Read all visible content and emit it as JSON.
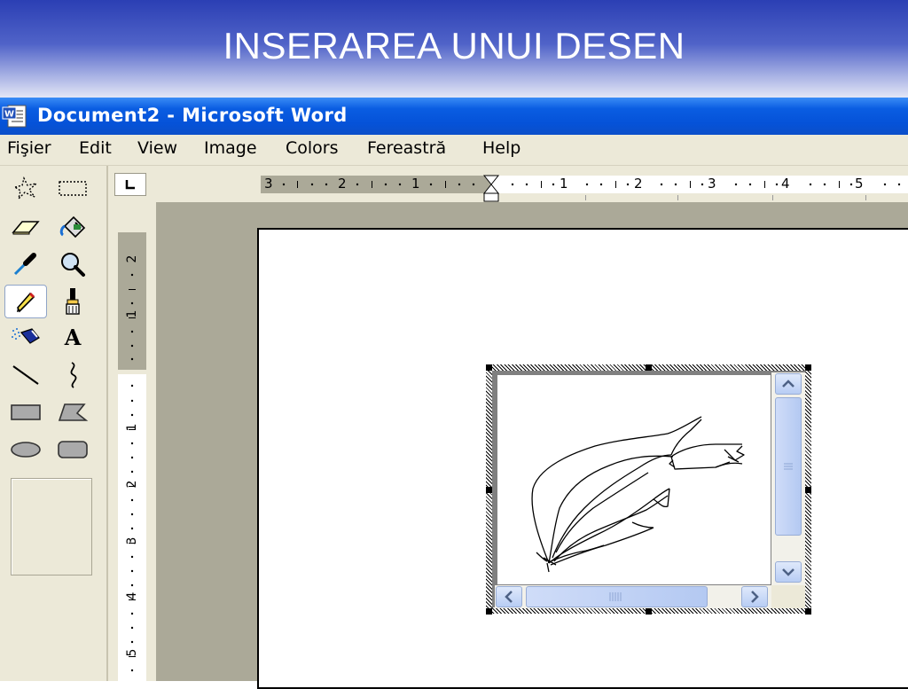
{
  "slide": {
    "title": "INSERAREA UNUI DESEN"
  },
  "window": {
    "title": "Document2 - Microsoft Word",
    "app_icon": "word-icon"
  },
  "menu": {
    "items": [
      {
        "label": "Fişier"
      },
      {
        "label": "Edit"
      },
      {
        "label": "View"
      },
      {
        "label": "Image"
      },
      {
        "label": "Colors"
      },
      {
        "label": "Fereastră"
      },
      {
        "label": "Help"
      }
    ]
  },
  "toolbox": {
    "tools": [
      {
        "icon": "free-form-select-icon"
      },
      {
        "icon": "select-icon"
      },
      {
        "icon": "eraser-icon"
      },
      {
        "icon": "fill-with-color-icon"
      },
      {
        "icon": "pick-color-icon"
      },
      {
        "icon": "magnifier-icon"
      },
      {
        "icon": "pencil-icon",
        "selected": true
      },
      {
        "icon": "brush-icon"
      },
      {
        "icon": "airbrush-icon"
      },
      {
        "icon": "text-icon",
        "glyph": "A"
      },
      {
        "icon": "line-icon"
      },
      {
        "icon": "curve-icon"
      },
      {
        "icon": "rectangle-icon"
      },
      {
        "icon": "polygon-icon"
      },
      {
        "icon": "ellipse-icon"
      },
      {
        "icon": "rounded-rectangle-icon"
      }
    ]
  },
  "horizontal_ruler": {
    "tick_labels": [
      "3",
      "2",
      "1",
      "1",
      "2",
      "3",
      "4",
      "5"
    ]
  },
  "vertical_ruler": {
    "tick_labels": [
      "2",
      "1",
      "1",
      "2",
      "3",
      "4",
      "5"
    ]
  },
  "colors": {
    "banner_top": "#2b3fb4",
    "titlebar": "#0552d8",
    "window_face": "#ece9d8",
    "workspace": "#aba998",
    "scroll_button": "#c4d6f7"
  }
}
